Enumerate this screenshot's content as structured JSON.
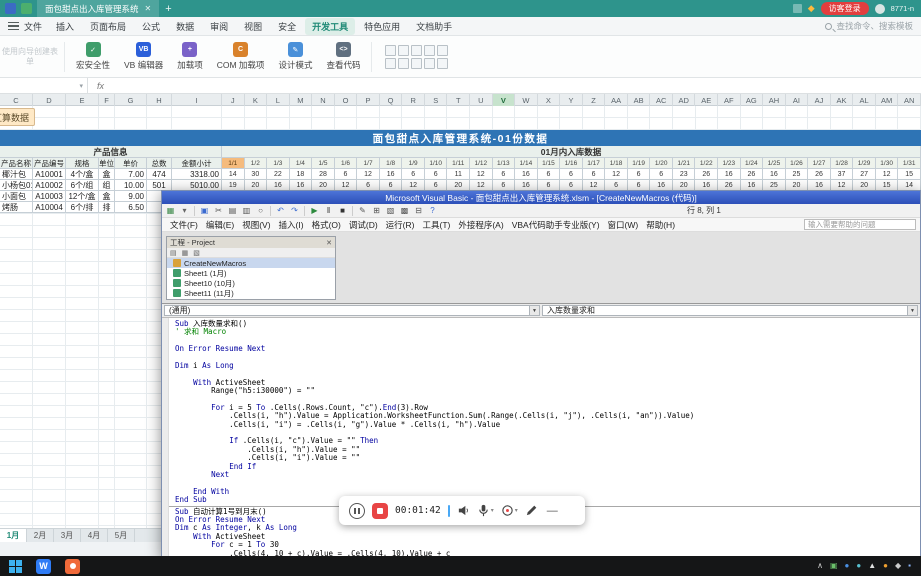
{
  "titlebar": {
    "doc_title": "面包甜点出入库管理系统",
    "login_label": "访客登录",
    "user_label": "8771-n"
  },
  "menubar": {
    "file_label": "文件",
    "tabs": [
      "插入",
      "页面布局",
      "公式",
      "数据",
      "审阅",
      "视图",
      "安全",
      "开发工具",
      "特色应用",
      "文档助手"
    ],
    "active_tab": "开发工具",
    "search_label": "查找命令、搜索模板"
  },
  "ribbon": {
    "disabled_label": "使用向导创建表单",
    "buttons": [
      "宏安全性",
      "VB 编辑器",
      "加载项",
      "COM 加载项",
      "设计模式",
      "查看代码"
    ],
    "control_icons": [
      "button-control-icon",
      "checkbox-control-icon",
      "textbox-control-icon",
      "combobox-control-icon",
      "listbox-control-icon",
      "label-control-icon",
      "image-control-icon",
      "scrollbar-control-icon",
      "spin-control-icon",
      "groupbox-control-icon"
    ]
  },
  "formula_bar": {
    "name_value": "",
    "fx_label": "fx"
  },
  "sheet": {
    "col_letters": [
      "C",
      "D",
      "E",
      "F",
      "G",
      "H",
      "I",
      "J",
      "K",
      "L",
      "M",
      "N",
      "O",
      "P",
      "Q",
      "R",
      "S",
      "T",
      "U",
      "V",
      "W",
      "X",
      "Y",
      "Z",
      "AA",
      "AB",
      "AC",
      "AD",
      "AE",
      "AF",
      "AG",
      "AH",
      "AI",
      "AJ",
      "AK",
      "AL",
      "AM",
      "AN"
    ],
    "highlight_col": "V",
    "calc_button_label": "汇算数据",
    "title": "面包甜点入库管理系统-01份数据",
    "left_band": "产品信息",
    "right_band": "01月内入库数据",
    "product_headers": [
      "产品名称",
      "产品编号",
      "规格",
      "单位",
      "单价",
      "总数",
      "金额小计"
    ],
    "date_headers": [
      "1/1",
      "1/2",
      "1/3",
      "1/4",
      "1/5",
      "1/6",
      "1/7",
      "1/8",
      "1/9",
      "1/10",
      "1/11",
      "1/12",
      "1/13",
      "1/14",
      "1/15",
      "1/16",
      "1/17",
      "1/18",
      "1/19",
      "1/20",
      "1/21",
      "1/22",
      "1/23",
      "1/24",
      "1/25",
      "1/26",
      "1/27",
      "1/28",
      "1/29",
      "1/30",
      "1/31"
    ],
    "highlight_date": "1/1",
    "rows": [
      {
        "name": "椰汁包",
        "code": "A10001",
        "spec": "4个/盒",
        "unit": "盒",
        "price": "7.00",
        "qty": "474",
        "amount": "3318.00",
        "days": [
          "14",
          "30",
          "22",
          "18",
          "28",
          "6",
          "12",
          "16",
          "6",
          "6",
          "11",
          "12",
          "6",
          "16",
          "6",
          "6",
          "6",
          "12",
          "6",
          "6",
          "23",
          "26",
          "16",
          "26",
          "16",
          "25",
          "26",
          "37",
          "27",
          "12",
          "15"
        ]
      },
      {
        "name": "小杨包01",
        "code": "A10002",
        "spec": "6个/组",
        "unit": "组",
        "price": "10.00",
        "qty": "501",
        "amount": "5010.00",
        "days": [
          "19",
          "20",
          "16",
          "16",
          "20",
          "12",
          "6",
          "6",
          "12",
          "6",
          "20",
          "12",
          "6",
          "16",
          "6",
          "6",
          "12",
          "6",
          "6",
          "16",
          "20",
          "16",
          "26",
          "16",
          "25",
          "20",
          "16",
          "12",
          "20",
          "15",
          "14"
        ]
      },
      {
        "name": "小面包",
        "code": "A10003",
        "spec": "12个/盒",
        "unit": "盒",
        "price": "9.00",
        "qty": "",
        "amount": "",
        "days": []
      },
      {
        "name": "烤肠",
        "code": "A10004",
        "spec": "6个/排",
        "unit": "排",
        "price": "6.50",
        "qty": "",
        "amount": "",
        "days": []
      }
    ],
    "tabs": [
      "1月",
      "2月",
      "3月",
      "4月",
      "5月"
    ],
    "active_sheet_tab": "1月"
  },
  "vba": {
    "title": "Microsoft Visual Basic - 面包甜点出入库管理系统.xlsm - [CreateNewMacros (代码)]",
    "toolbar_icons": [
      "view-object-icon",
      "insert-userform-icon",
      "save-icon",
      "cut-icon",
      "copy-icon",
      "paste-icon",
      "find-icon",
      "undo-icon",
      "redo-icon",
      "run-icon",
      "break-icon",
      "reset-icon",
      "design-mode-icon",
      "project-explorer-icon",
      "properties-icon",
      "object-browser-icon",
      "toolbox-icon",
      "help-icon"
    ],
    "position_indicator": "行 8, 列 1",
    "menus": [
      "文件(F)",
      "编辑(E)",
      "视图(V)",
      "插入(I)",
      "格式(O)",
      "调试(D)",
      "运行(R)",
      "工具(T)",
      "外接程序(A)",
      "VBA代码助手专业版(Y)",
      "窗口(W)",
      "帮助(H)"
    ],
    "help_box": "输入需要帮助的问题",
    "project": {
      "title": "工程 - Project",
      "items": [
        "CreateNewMacros",
        "Sheet1 (1月)",
        "Sheet10 (10月)",
        "Sheet11 (11月)"
      ],
      "selected": "CreateNewMacros"
    },
    "combo_left": "(通用)",
    "combo_right": "入库数量求和",
    "code": [
      "Sub 入库数量求和()",
      "' 求和 Macro",
      "",
      "On Error Resume Next",
      "",
      "Dim i As Long",
      "",
      "    With ActiveSheet",
      "        Range(\"h5:i30000\") = \"\"",
      "",
      "        For i = 5 To .Cells(.Rows.Count, \"c\").End(3).Row",
      "            .Cells(i, \"h\").Value = Application.WorksheetFunction.Sum(.Range(.Cells(i, \"j\"), .Cells(i, \"an\")).Value)",
      "            .Cells(i, \"i\") = .Cells(i, \"g\").Value * .Cells(i, \"h\").Value",
      "",
      "            If .Cells(i, \"c\").Value = \"\" Then",
      "                .Cells(i, \"h\").Value = \"\"",
      "                .Cells(i, \"i\").Value = \"\"",
      "            End If",
      "        Next",
      "",
      "    End With",
      "End Sub",
      "---",
      "Sub 自动计算1号到月末()",
      "On Error Resume Next",
      "Dim c As Integer, k As Long",
      "    With ActiveSheet",
      "        For c = 1 To 30",
      "            .Cells(4, 10 + c).Value = .Cells(4, 10).Value + c"
    ]
  },
  "recorder": {
    "time": "00:01:42"
  },
  "taskbar": {
    "tray_icons": [
      "tray-expand-icon",
      "defender-icon",
      "cloud-icon",
      "bluetooth-icon",
      "input-method-icon",
      "update-icon",
      "volume-icon",
      "network-icon"
    ]
  }
}
